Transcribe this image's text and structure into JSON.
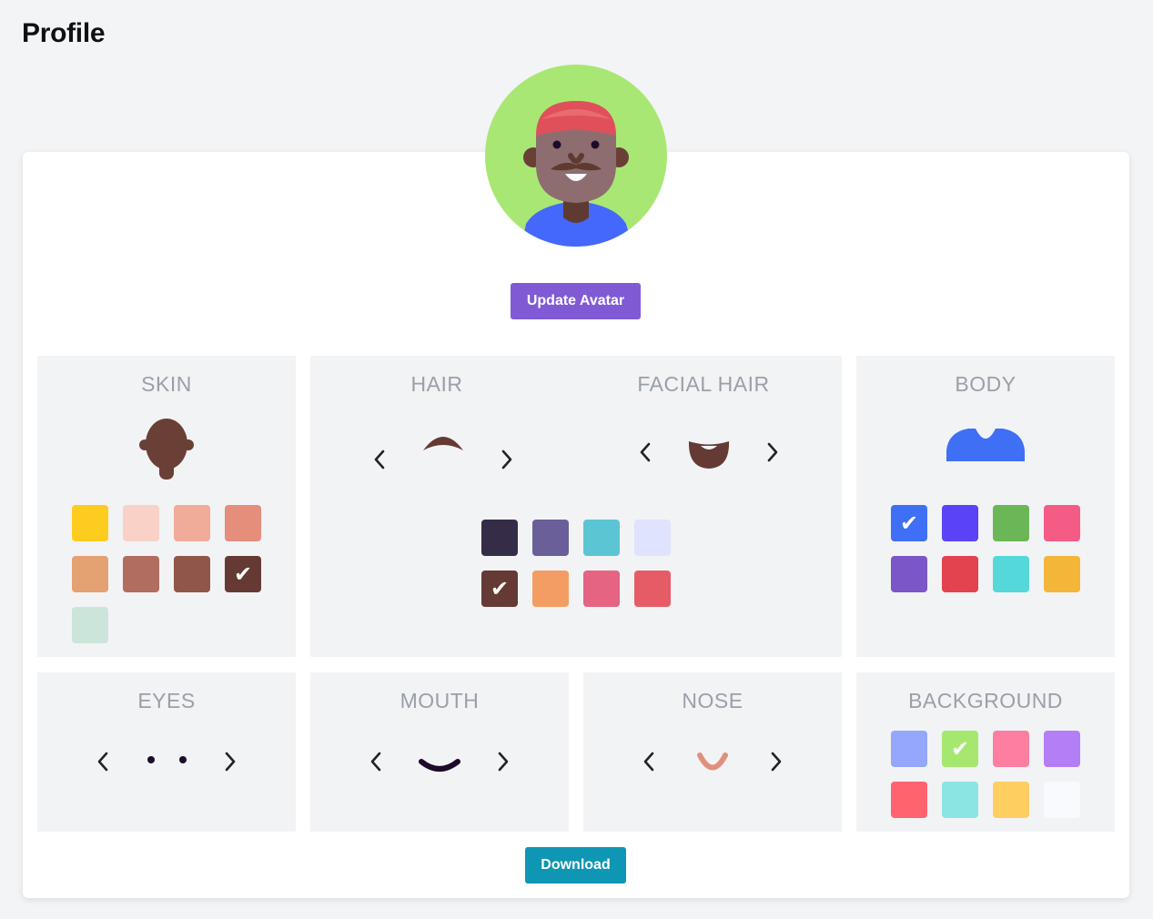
{
  "page": {
    "title": "Profile"
  },
  "avatar": {
    "background": "#a9e774",
    "skin": "#8e6d70",
    "hat": "#e0505a",
    "shirt": "#4468fb"
  },
  "buttons": {
    "update_avatar": "Update Avatar",
    "download": "Download"
  },
  "panels": {
    "skin": {
      "title": "SKIN",
      "swatches": [
        {
          "color": "#fdcc1f",
          "selected": false
        },
        {
          "color": "#f9d1c6",
          "selected": false
        },
        {
          "color": "#f0ab99",
          "selected": false
        },
        {
          "color": "#e48e7b",
          "selected": false
        },
        {
          "color": "#e4a172",
          "selected": false
        },
        {
          "color": "#b16d5f",
          "selected": false
        },
        {
          "color": "#8f5649",
          "selected": false
        },
        {
          "color": "#653a34",
          "selected": true
        },
        {
          "color": "#cbe5da",
          "selected": false
        }
      ]
    },
    "hair": {
      "title": "HAIR"
    },
    "facial_hair": {
      "title": "FACIAL HAIR"
    },
    "hair_colors": [
      {
        "color": "#352c48",
        "selected": false
      },
      {
        "color": "#6a5f99",
        "selected": false
      },
      {
        "color": "#5bc5d3",
        "selected": false
      },
      {
        "color": "#dfe3fd",
        "selected": false
      },
      {
        "color": "#653a34",
        "selected": true
      },
      {
        "color": "#f39d64",
        "selected": false
      },
      {
        "color": "#e46482",
        "selected": false
      },
      {
        "color": "#e65c66",
        "selected": false
      }
    ],
    "body": {
      "title": "BODY",
      "swatches": [
        {
          "color": "#3f6ff5",
          "selected": true
        },
        {
          "color": "#5a43f7",
          "selected": false
        },
        {
          "color": "#6bb757",
          "selected": false
        },
        {
          "color": "#f45c86",
          "selected": false
        },
        {
          "color": "#7a56c8",
          "selected": false
        },
        {
          "color": "#e2434f",
          "selected": false
        },
        {
          "color": "#54d9d8",
          "selected": false
        },
        {
          "color": "#f3b638",
          "selected": false
        }
      ]
    },
    "eyes": {
      "title": "EYES"
    },
    "mouth": {
      "title": "MOUTH"
    },
    "nose": {
      "title": "NOSE"
    },
    "background": {
      "title": "BACKGROUND",
      "swatches": [
        {
          "color": "#94a7fc",
          "selected": false
        },
        {
          "color": "#a6e770",
          "selected": true
        },
        {
          "color": "#fd7ea0",
          "selected": false
        },
        {
          "color": "#b47ef6",
          "selected": false
        },
        {
          "color": "#fe636e",
          "selected": false
        },
        {
          "color": "#8ae5e3",
          "selected": false
        },
        {
          "color": "#fece61",
          "selected": false
        },
        {
          "color": "#f8fafd",
          "selected": false
        }
      ]
    }
  },
  "icons": {
    "check": "✔",
    "prev": "chevron-left-icon",
    "next": "chevron-right-icon"
  }
}
